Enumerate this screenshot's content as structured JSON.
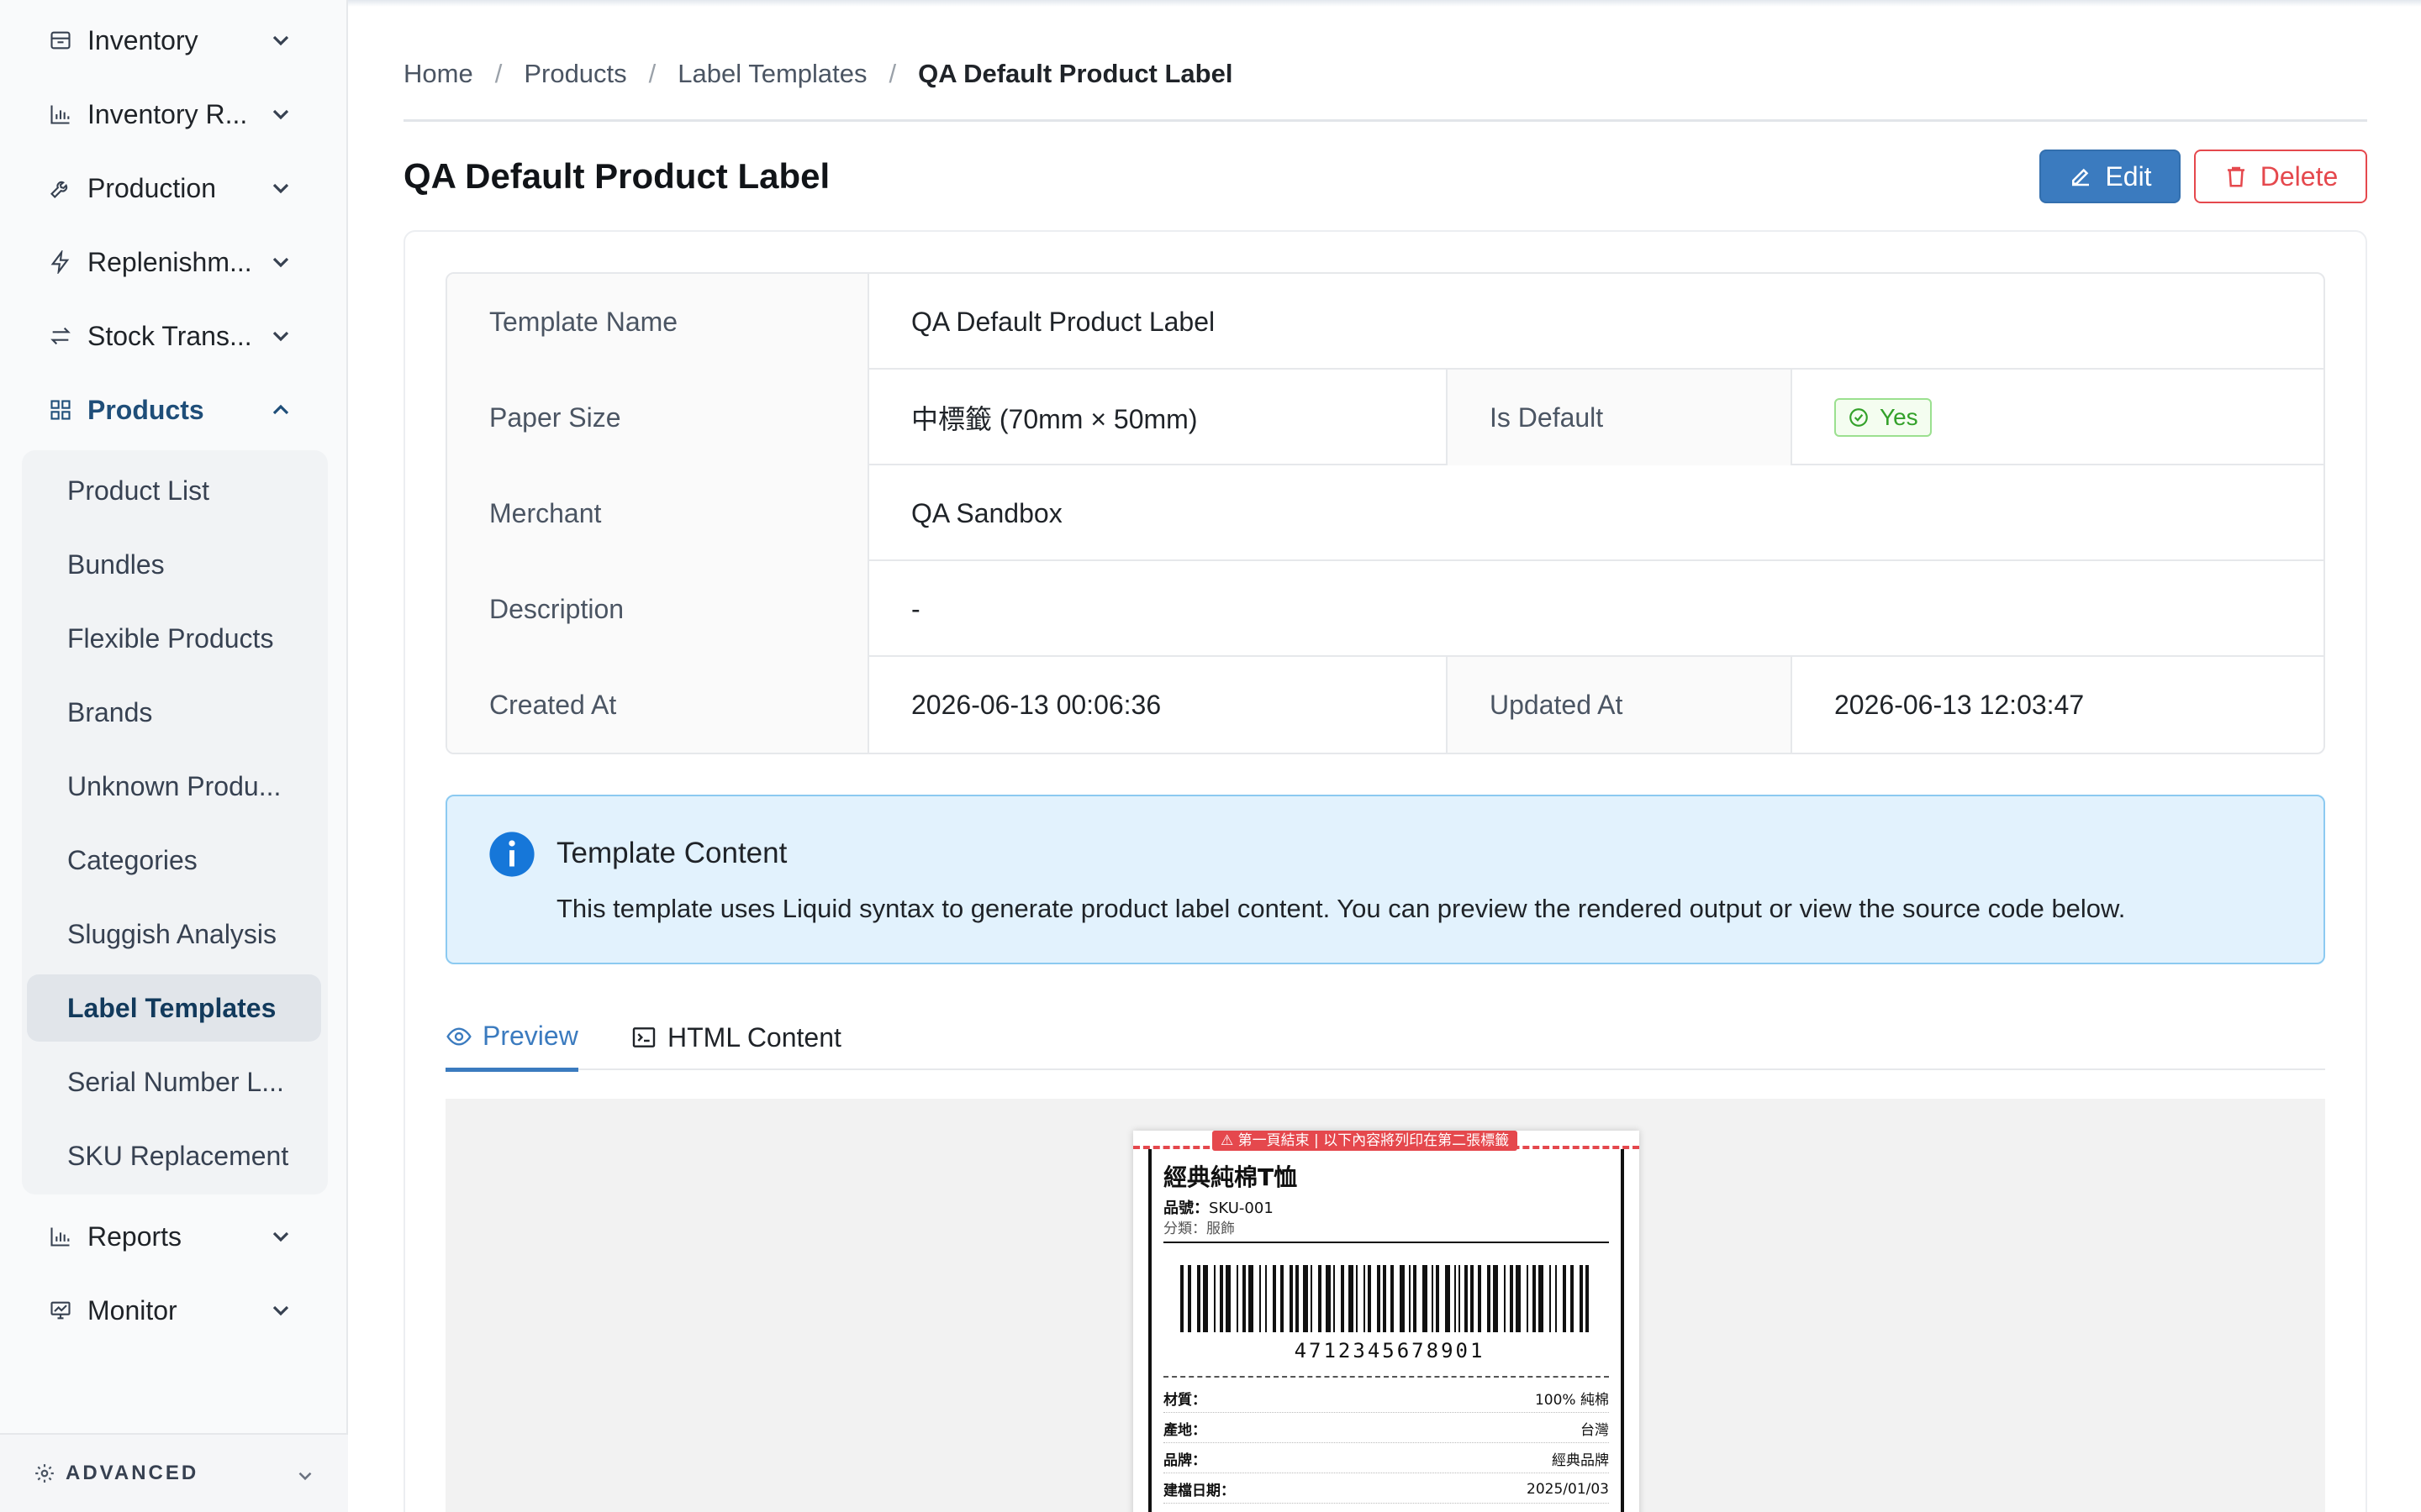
{
  "sidebar": {
    "items": [
      {
        "label": "Inventory",
        "icon": "box-icon"
      },
      {
        "label": "Inventory R...",
        "icon": "bar-chart-icon"
      },
      {
        "label": "Production",
        "icon": "wrench-icon"
      },
      {
        "label": "Replenishm...",
        "icon": "lightning-icon"
      },
      {
        "label": "Stock Trans...",
        "icon": "transfer-icon"
      },
      {
        "label": "Products",
        "icon": "grid-icon"
      },
      {
        "label": "Reports",
        "icon": "bar-chart-icon"
      },
      {
        "label": "Monitor",
        "icon": "monitor-chart-icon"
      }
    ],
    "products_sub": [
      "Product List",
      "Bundles",
      "Flexible Products",
      "Brands",
      "Unknown Produ...",
      "Categories",
      "Sluggish Analysis",
      "Label Templates",
      "Serial Number L...",
      "SKU Replacement"
    ],
    "advanced_label": "ADVANCED"
  },
  "breadcrumb": [
    "Home",
    "Products",
    "Label Templates",
    "QA Default Product Label"
  ],
  "breadcrumb_sep": "/",
  "page": {
    "title": "QA Default Product Label",
    "edit_label": "Edit",
    "delete_label": "Delete"
  },
  "details": {
    "template_name_label": "Template Name",
    "template_name": "QA Default Product Label",
    "paper_size_label": "Paper Size",
    "paper_size": "中標籤 (70mm × 50mm)",
    "is_default_label": "Is Default",
    "is_default": "Yes",
    "merchant_label": "Merchant",
    "merchant": "QA Sandbox",
    "description_label": "Description",
    "description": "-",
    "created_at_label": "Created At",
    "created_at": "2026-06-13 00:06:36",
    "updated_at_label": "Updated At",
    "updated_at": "2026-06-13 12:03:47"
  },
  "alert": {
    "title": "Template Content",
    "text": "This template uses Liquid syntax to generate product label content. You can preview the rendered output or view the source code below."
  },
  "tabs": {
    "preview": "Preview",
    "html": "HTML Content"
  },
  "label_preview": {
    "page_break_notice": "⚠ 第一頁結束 | 以下內容將列印在第二張標籤",
    "product_name": "經典純棉T恤",
    "sku_label": "品號：",
    "sku": "SKU-001",
    "category": "分類：服飾",
    "barcode_number": "4712345678901",
    "specs": [
      {
        "k": "材質：",
        "v": "100% 純棉"
      },
      {
        "k": "產地：",
        "v": "台灣"
      },
      {
        "k": "品牌：",
        "v": "經典品牌"
      },
      {
        "k": "建檔日期：",
        "v": "2025/01/03"
      }
    ]
  },
  "colors": {
    "accent": "#3b7bbf",
    "danger": "#e5484d",
    "success": "#33a12a",
    "info_bg": "#e2f2fd"
  }
}
